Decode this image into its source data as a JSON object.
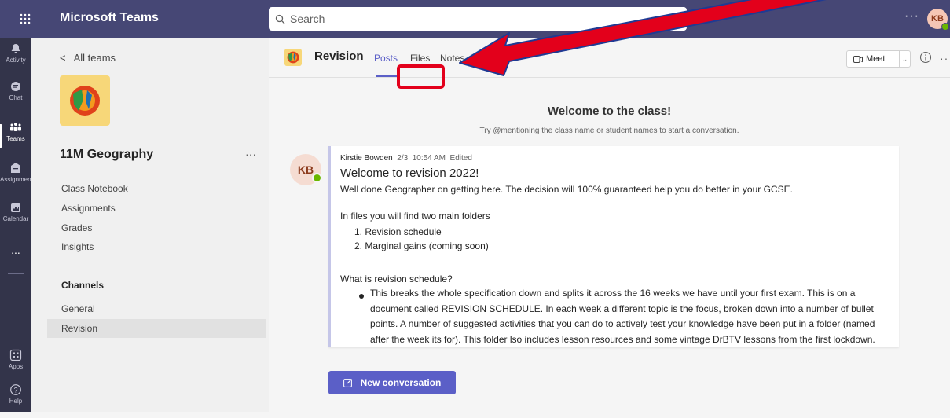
{
  "app": {
    "title": "Microsoft Teams"
  },
  "search": {
    "placeholder": "Search"
  },
  "user": {
    "initials": "KB"
  },
  "rail": [
    {
      "label": "Activity",
      "icon": "bell-icon"
    },
    {
      "label": "Chat",
      "icon": "chat-icon"
    },
    {
      "label": "Teams",
      "icon": "teams-icon"
    },
    {
      "label": "Assignments",
      "icon": "assignments-icon"
    },
    {
      "label": "Calendar",
      "icon": "calendar-icon"
    },
    {
      "label": "...",
      "icon": "more-icon"
    },
    {
      "label": "Apps",
      "icon": "apps-icon"
    },
    {
      "label": "Help",
      "icon": "help-icon"
    }
  ],
  "sidebar": {
    "back_label": "All teams",
    "team_name": "11M Geography",
    "more": "···",
    "links": [
      "Class Notebook",
      "Assignments",
      "Grades",
      "Insights"
    ],
    "channels_heading": "Channels",
    "channels": [
      "General",
      "Revision"
    ]
  },
  "channel": {
    "name": "Revision",
    "tabs": [
      "Posts",
      "Files",
      "Notes"
    ],
    "meet_label": "Meet",
    "more": "···"
  },
  "welcome": {
    "title": "Welcome to the class!",
    "subtitle": "Try @mentioning the class name or student names to start a conversation."
  },
  "post": {
    "author_initials": "KB",
    "author": "Kirstie Bowden",
    "timestamp": "2/3, 10:54 AM",
    "edited": "Edited",
    "title": "Welcome to revision 2022!",
    "line1": "Well done Geographer on getting here. The decision will 100% guaranteed help you do better in your GCSE.",
    "line2": "In files you will find two main folders",
    "list": [
      "1. Revision schedule",
      "2. Marginal gains (coming soon)"
    ],
    "line3": "What is revision schedule?",
    "bullet": "This breaks the whole specification down and splits it across the 16 weeks we have until your first exam. This is on a document called REVISION SCHEDULE.  In each week a different topic is the focus, broken down into a number of bullet points. A number of suggested activities that you can do to actively test your knowledge have been put in a folder (named after the week its for). This folder lso includes lesson resources and some vintage DrBTV lessons from the first lockdown. PLEASE DOWNLOAD AND SAVE ANYTHING YOU USE - Don't change my copy. If you want"
  },
  "compose": {
    "label": "New conversation"
  },
  "colors": {
    "brand": "#464775",
    "rail": "#33344a",
    "accent": "#5b5fc7",
    "annotation": "#e3001b"
  }
}
